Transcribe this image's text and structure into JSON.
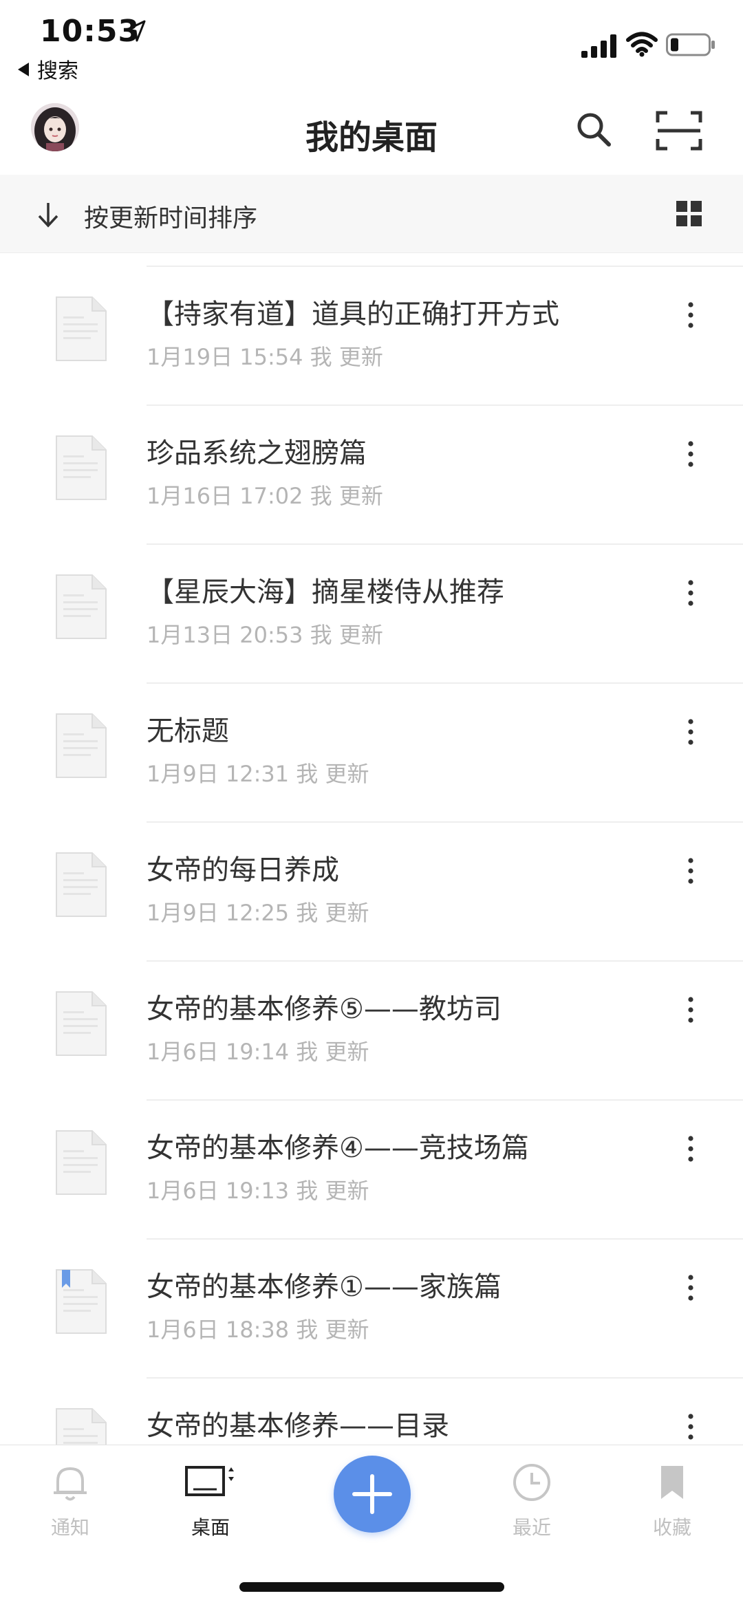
{
  "status_bar": {
    "time": "10:53",
    "back_app": "搜索"
  },
  "header": {
    "title": "我的桌面"
  },
  "sort_bar": {
    "label": "按更新时间排序"
  },
  "documents": [
    {
      "title": "【持家有道】道具的正确打开方式",
      "meta": "1月19日 15:54 我 更新",
      "bookmarked": false
    },
    {
      "title": "珍品系统之翅膀篇",
      "meta": "1月16日 17:02 我 更新",
      "bookmarked": false
    },
    {
      "title": "【星辰大海】摘星楼侍从推荐",
      "meta": "1月13日 20:53 我 更新",
      "bookmarked": false
    },
    {
      "title": "无标题",
      "meta": "1月9日 12:31 我 更新",
      "bookmarked": false
    },
    {
      "title": "女帝的每日养成",
      "meta": "1月9日 12:25 我 更新",
      "bookmarked": false
    },
    {
      "title": "女帝的基本修养⑤——教坊司",
      "meta": "1月6日 19:14 我 更新",
      "bookmarked": false
    },
    {
      "title": "女帝的基本修养④——竞技场篇",
      "meta": "1月6日 19:13 我 更新",
      "bookmarked": false
    },
    {
      "title": "女帝的基本修养①——家族篇",
      "meta": "1月6日 18:38 我 更新",
      "bookmarked": true
    },
    {
      "title": "女帝的基本修养——目录",
      "meta": "",
      "bookmarked": false
    }
  ],
  "tab_bar": {
    "tabs": [
      {
        "label": "通知",
        "icon": "bell-icon",
        "active": false
      },
      {
        "label": "桌面",
        "icon": "desktop-icon",
        "active": true
      },
      {
        "label": "最近",
        "icon": "clock-icon",
        "active": false
      },
      {
        "label": "收藏",
        "icon": "bookmark-icon",
        "active": false
      }
    ],
    "add_icon": "plus-icon"
  },
  "colors": {
    "accent": "#5b8fe8",
    "meta_text": "#b5b5b5",
    "inactive_tab": "#c0c0c0"
  }
}
